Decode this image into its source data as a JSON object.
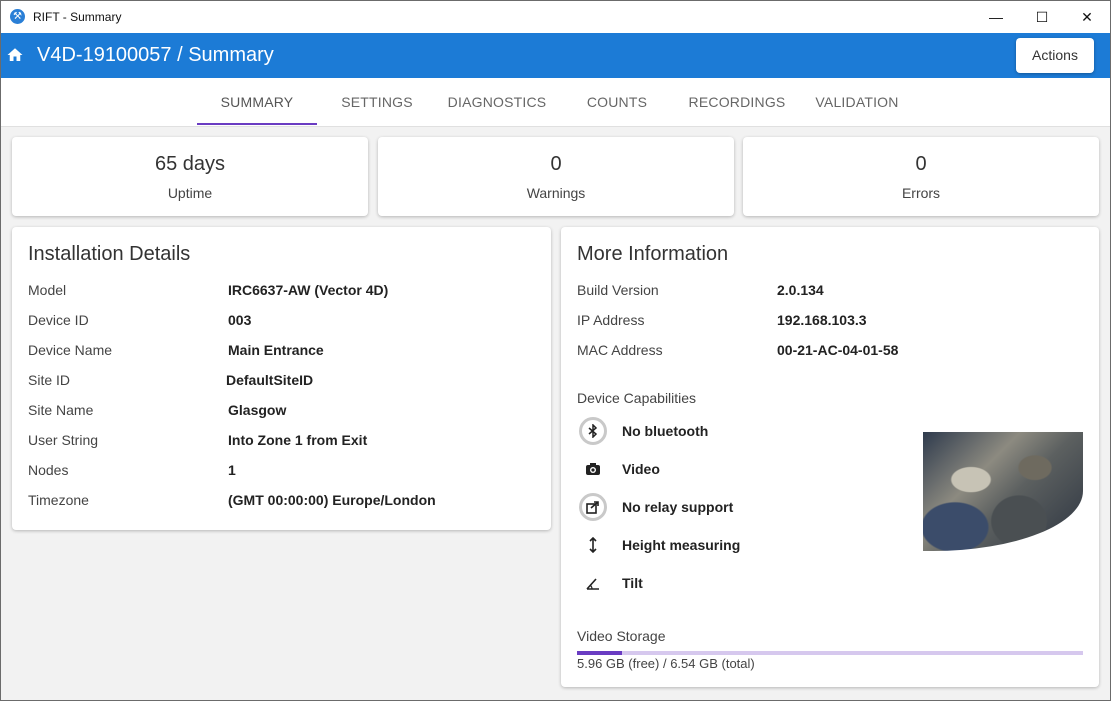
{
  "window": {
    "title": "RIFT - Summary",
    "minimize": "—",
    "maximize": "☐",
    "close": "✕"
  },
  "header": {
    "title": "V4D-19100057 / Summary",
    "actions_label": "Actions"
  },
  "tabs": [
    {
      "label": "SUMMARY",
      "active": true
    },
    {
      "label": "SETTINGS"
    },
    {
      "label": "DIAGNOSTICS"
    },
    {
      "label": "COUNTS"
    },
    {
      "label": "RECORDINGS"
    },
    {
      "label": "VALIDATION"
    }
  ],
  "stats": [
    {
      "value": "65 days",
      "label": "Uptime"
    },
    {
      "value": "0",
      "label": "Warnings"
    },
    {
      "value": "0",
      "label": "Errors"
    }
  ],
  "installation": {
    "title": "Installation Details",
    "rows": [
      {
        "key": "Model",
        "value": "IRC6637-AW (Vector 4D)"
      },
      {
        "key": "Device ID",
        "value": "003"
      },
      {
        "key": "Device Name",
        "value": "Main Entrance"
      },
      {
        "key": "Site ID",
        "value": "DefaultSiteID"
      },
      {
        "key": "Site Name",
        "value": "Glasgow"
      },
      {
        "key": "User String",
        "value": "Into Zone 1 from Exit"
      },
      {
        "key": "Nodes",
        "value": "1"
      },
      {
        "key": "Timezone",
        "value": "(GMT 00:00:00) Europe/London"
      }
    ]
  },
  "more_info": {
    "title": "More Information",
    "rows": [
      {
        "key": "Build Version",
        "value": "2.0.134"
      },
      {
        "key": "IP Address",
        "value": "192.168.103.3"
      },
      {
        "key": "MAC Address",
        "value": "00-21-AC-04-01-58"
      }
    ],
    "capabilities_title": "Device Capabilities",
    "capabilities": [
      {
        "icon": "bluetooth-disabled-icon",
        "label": "No bluetooth"
      },
      {
        "icon": "camera-icon",
        "label": "Video"
      },
      {
        "icon": "relay-disabled-icon",
        "label": "No relay support"
      },
      {
        "icon": "height-arrows-icon",
        "label": "Height measuring"
      },
      {
        "icon": "tilt-angle-icon",
        "label": "Tilt"
      }
    ],
    "storage_title": "Video Storage",
    "storage_text": "5.96 GB (free) / 6.54 GB (total)",
    "storage_used_fraction": 0.089
  },
  "colors": {
    "appbar": "#1c7bd6",
    "accent": "#6a3cc2"
  }
}
